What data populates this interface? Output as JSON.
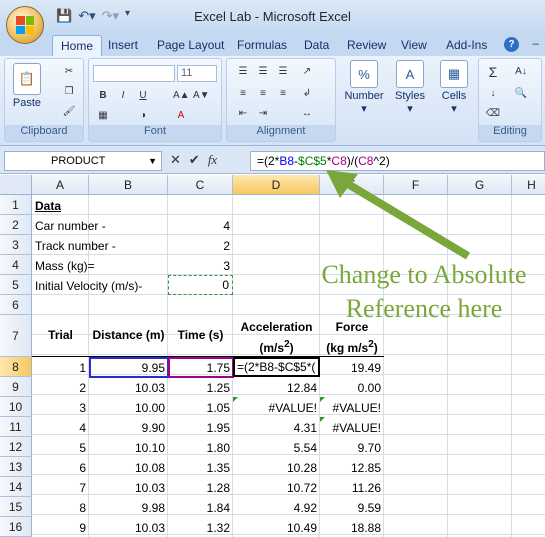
{
  "window": {
    "title": "Excel Lab - Microsoft Excel"
  },
  "ribbon_tabs": [
    "Home",
    "Insert",
    "Page Layout",
    "Formulas",
    "Data",
    "Review",
    "View",
    "Add-Ins"
  ],
  "ribbon": {
    "clipboard_label": "Clipboard",
    "paste_label": "Paste",
    "font_label": "Font",
    "font_size": "11",
    "alignment_label": "Alignment",
    "number_label": "Number",
    "number_icon_text": "%",
    "styles_label": "Styles",
    "cells_label": "Cells",
    "editing_label": "Editing"
  },
  "formula_bar": {
    "name_box": "PRODUCT",
    "formula_parts": [
      "=(2*",
      "B8",
      "-",
      "$C$5",
      "*",
      "C8",
      ")/(",
      "C8",
      "^2)"
    ]
  },
  "columns": [
    "A",
    "B",
    "C",
    "D",
    "E",
    "F",
    "G",
    "H"
  ],
  "rows": [
    "1",
    "2",
    "3",
    "4",
    "5",
    "6",
    "7",
    "8",
    "9",
    "10",
    "11",
    "12",
    "13",
    "14",
    "15",
    "16"
  ],
  "cells": {
    "a1": "Data",
    "a2": "Car number -",
    "c2": "4",
    "a3": "Track number -",
    "c3": "2",
    "a4": "Mass (kg)=",
    "c4": "3",
    "a5": "Initial Velocity (m/s)-",
    "c5": "0",
    "a7": "Trial",
    "b7": "Distance (m)",
    "c7": "Time (s)",
    "d7": "Acceleration",
    "d7b": "(m/s",
    "e7": "Force",
    "e7b": "(kg m/s",
    "d8_edit": "=(2*B8-$C$5*("
  },
  "table": [
    {
      "trial": "1",
      "distance": "9.95",
      "time": "1.75",
      "accel": "",
      "force": "19.49"
    },
    {
      "trial": "2",
      "distance": "10.03",
      "time": "1.25",
      "accel": "12.84",
      "force": "0.00"
    },
    {
      "trial": "3",
      "distance": "10.00",
      "time": "1.05",
      "accel": "#VALUE!",
      "force": "#VALUE!"
    },
    {
      "trial": "4",
      "distance": "9.90",
      "time": "1.95",
      "accel": "4.31",
      "force": "#VALUE!"
    },
    {
      "trial": "5",
      "distance": "10.10",
      "time": "1.80",
      "accel": "5.54",
      "force": "9.70"
    },
    {
      "trial": "6",
      "distance": "10.08",
      "time": "1.35",
      "accel": "10.28",
      "force": "12.85"
    },
    {
      "trial": "7",
      "distance": "10.03",
      "time": "1.28",
      "accel": "10.72",
      "force": "11.26"
    },
    {
      "trial": "8",
      "distance": "9.98",
      "time": "1.84",
      "accel": "4.92",
      "force": "9.59"
    },
    {
      "trial": "9",
      "distance": "10.03",
      "time": "1.32",
      "accel": "10.49",
      "force": "18.88"
    }
  ],
  "annotation": {
    "line1": "Change to Absolute",
    "line2": "Reference here",
    "color": "#7aa73a"
  }
}
